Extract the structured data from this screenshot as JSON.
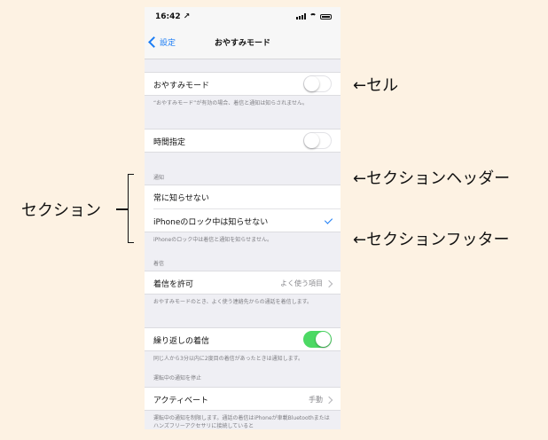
{
  "status": {
    "time": "16:42 ↗"
  },
  "nav": {
    "back_label": "設定",
    "title": "おやすみモード"
  },
  "cells": {
    "dnd": {
      "label": "おやすみモード"
    },
    "dnd_footer": "“おやすみモード”が有効の場合、着信と通知は知らされません。",
    "scheduled": {
      "label": "時間指定"
    },
    "notify_header": "通知",
    "always": {
      "label": "常に知らせない"
    },
    "locked": {
      "label": "iPhoneのロック中は知らせない"
    },
    "locked_footer": "iPhoneのロック中は着信と通知を知らせません。",
    "calls_header": "着信",
    "allow_calls": {
      "label": "着信を許可",
      "value": "よく使う項目"
    },
    "allow_calls_footer": "おやすみモードのとき、よく使う連絡先からの通話を着信します。",
    "repeated": {
      "label": "繰り返しの着信"
    },
    "repeated_footer": "同じ人から3分以内に2度目の着信があったときは通知します。",
    "driving_header": "運転中の通知を停止",
    "activate": {
      "label": "アクティベート",
      "value": "手動"
    },
    "activate_footer": "運転中の通知を制限します。通話の着信はiPhoneが車載Bluetoothまたはハンズフリーアクセサリに接続していると"
  },
  "toggles": {
    "dnd": false,
    "scheduled": false,
    "repeated": true
  },
  "annotations": {
    "cell": "←セル",
    "section_header": "←セクションヘッダー",
    "section": "セクション",
    "section_footer": "←セクションフッター"
  },
  "colors": {
    "accent": "#1a7cf5",
    "toggle_on": "#4cd964",
    "background": "#fdf2e3"
  }
}
